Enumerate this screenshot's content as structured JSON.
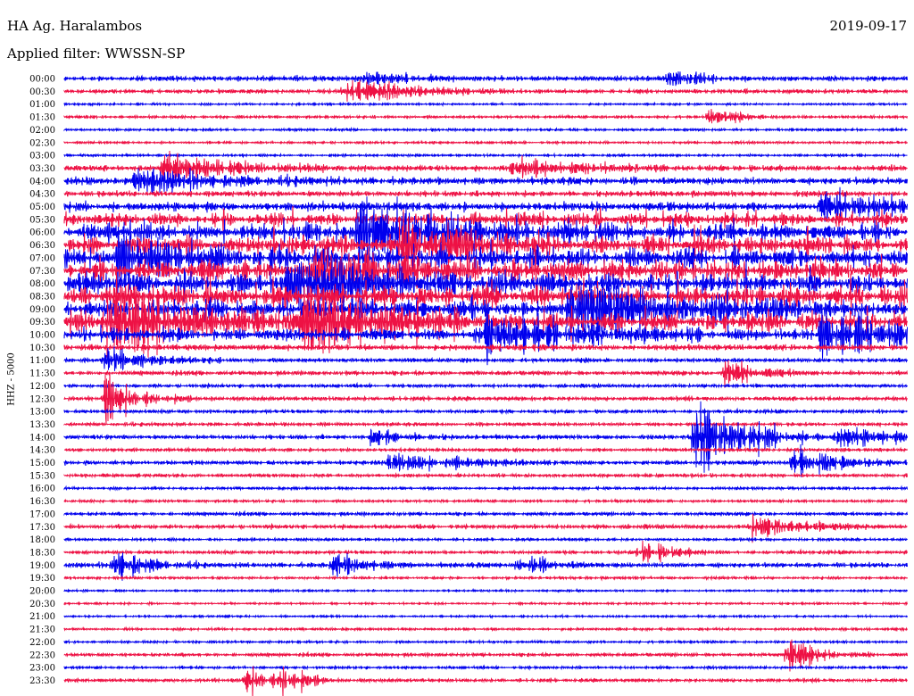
{
  "header": {
    "station": "HA Ag. Haralambos",
    "date": "2019-09-17",
    "filter": "Applied filter: WWSSN-SP"
  },
  "chart_data": {
    "type": "line",
    "subtype": "helicorder",
    "ylabel": "HHZ - 5000",
    "row_labels": [
      "00:00",
      "00:30",
      "01:00",
      "01:30",
      "02:00",
      "02:30",
      "03:00",
      "03:30",
      "04:00",
      "04:30",
      "05:00",
      "05:30",
      "06:00",
      "06:30",
      "07:00",
      "07:30",
      "08:00",
      "08:30",
      "09:00",
      "09:30",
      "10:00",
      "10:30",
      "11:00",
      "11:30",
      "12:00",
      "12:30",
      "13:00",
      "13:30",
      "14:00",
      "14:30",
      "15:00",
      "15:30",
      "16:00",
      "16:30",
      "17:00",
      "17:30",
      "18:00",
      "18:30",
      "19:00",
      "19:30",
      "20:00",
      "20:30",
      "21:00",
      "21:30",
      "22:00",
      "22:30",
      "23:00",
      "23:30"
    ],
    "colors": [
      "#0000ee",
      "#ee1144"
    ],
    "row_activity": [
      0.25,
      0.2,
      0.05,
      0.1,
      0.08,
      0.08,
      0.08,
      0.3,
      0.4,
      0.3,
      0.5,
      0.6,
      0.85,
      0.9,
      0.95,
      1.0,
      0.95,
      1.0,
      0.95,
      0.9,
      0.6,
      0.3,
      0.2,
      0.2,
      0.15,
      0.2,
      0.15,
      0.15,
      0.2,
      0.15,
      0.2,
      0.15,
      0.1,
      0.1,
      0.15,
      0.2,
      0.1,
      0.15,
      0.25,
      0.1,
      0.05,
      0.05,
      0.05,
      0.08,
      0.08,
      0.15,
      0.1,
      0.15
    ],
    "events": [
      {
        "row": 0,
        "minute": 10.5,
        "amp": 0.7,
        "dur": 1.5
      },
      {
        "row": 0,
        "minute": 21.5,
        "amp": 0.8,
        "dur": 1.0
      },
      {
        "row": 1,
        "minute": 10.0,
        "amp": 1.2,
        "dur": 2.0
      },
      {
        "row": 3,
        "minute": 23.0,
        "amp": 0.8,
        "dur": 1.0
      },
      {
        "row": 7,
        "minute": 3.5,
        "amp": 1.8,
        "dur": 2.0
      },
      {
        "row": 7,
        "minute": 16.0,
        "amp": 1.2,
        "dur": 2.0
      },
      {
        "row": 8,
        "minute": 2.5,
        "amp": 1.2,
        "dur": 2.5
      },
      {
        "row": 10,
        "minute": 27.0,
        "amp": 1.5,
        "dur": 2.0
      },
      {
        "row": 12,
        "minute": 10.5,
        "amp": 3.0,
        "dur": 3.0
      },
      {
        "row": 13,
        "minute": 12.0,
        "amp": 3.0,
        "dur": 2.0
      },
      {
        "row": 14,
        "minute": 2.0,
        "amp": 2.5,
        "dur": 2.0
      },
      {
        "row": 15,
        "minute": 9.0,
        "amp": 2.5,
        "dur": 2.0
      },
      {
        "row": 16,
        "minute": 8.0,
        "amp": 2.5,
        "dur": 3.0
      },
      {
        "row": 18,
        "minute": 18.0,
        "amp": 3.0,
        "dur": 3.0
      },
      {
        "row": 19,
        "minute": 1.5,
        "amp": 3.5,
        "dur": 3.0
      },
      {
        "row": 19,
        "minute": 8.5,
        "amp": 3.5,
        "dur": 2.5
      },
      {
        "row": 20,
        "minute": 15.0,
        "amp": 2.5,
        "dur": 2.5
      },
      {
        "row": 20,
        "minute": 27.0,
        "amp": 2.5,
        "dur": 2.0
      },
      {
        "row": 22,
        "minute": 1.5,
        "amp": 1.2,
        "dur": 1.5
      },
      {
        "row": 23,
        "minute": 23.5,
        "amp": 1.5,
        "dur": 1.0
      },
      {
        "row": 25,
        "minute": 1.5,
        "amp": 2.5,
        "dur": 1.0
      },
      {
        "row": 28,
        "minute": 11.0,
        "amp": 1.0,
        "dur": 1.0
      },
      {
        "row": 28,
        "minute": 27.5,
        "amp": 1.0,
        "dur": 2.0
      },
      {
        "row": 28,
        "minute": 22.5,
        "amp": 5.0,
        "dur": 1.5
      },
      {
        "row": 30,
        "minute": 11.5,
        "amp": 1.2,
        "dur": 2.0
      },
      {
        "row": 30,
        "minute": 26.0,
        "amp": 1.5,
        "dur": 1.5
      },
      {
        "row": 35,
        "minute": 24.5,
        "amp": 1.2,
        "dur": 1.5
      },
      {
        "row": 37,
        "minute": 20.5,
        "amp": 1.2,
        "dur": 1.0
      },
      {
        "row": 38,
        "minute": 1.8,
        "amp": 1.8,
        "dur": 1.0
      },
      {
        "row": 38,
        "minute": 9.6,
        "amp": 1.2,
        "dur": 1.0
      },
      {
        "row": 38,
        "minute": 16.2,
        "amp": 1.0,
        "dur": 1.0
      },
      {
        "row": 45,
        "minute": 25.8,
        "amp": 1.5,
        "dur": 1.0
      },
      {
        "row": 47,
        "minute": 6.5,
        "amp": 1.5,
        "dur": 1.0
      },
      {
        "row": 47,
        "minute": 7.8,
        "amp": 1.6,
        "dur": 0.6
      }
    ]
  }
}
